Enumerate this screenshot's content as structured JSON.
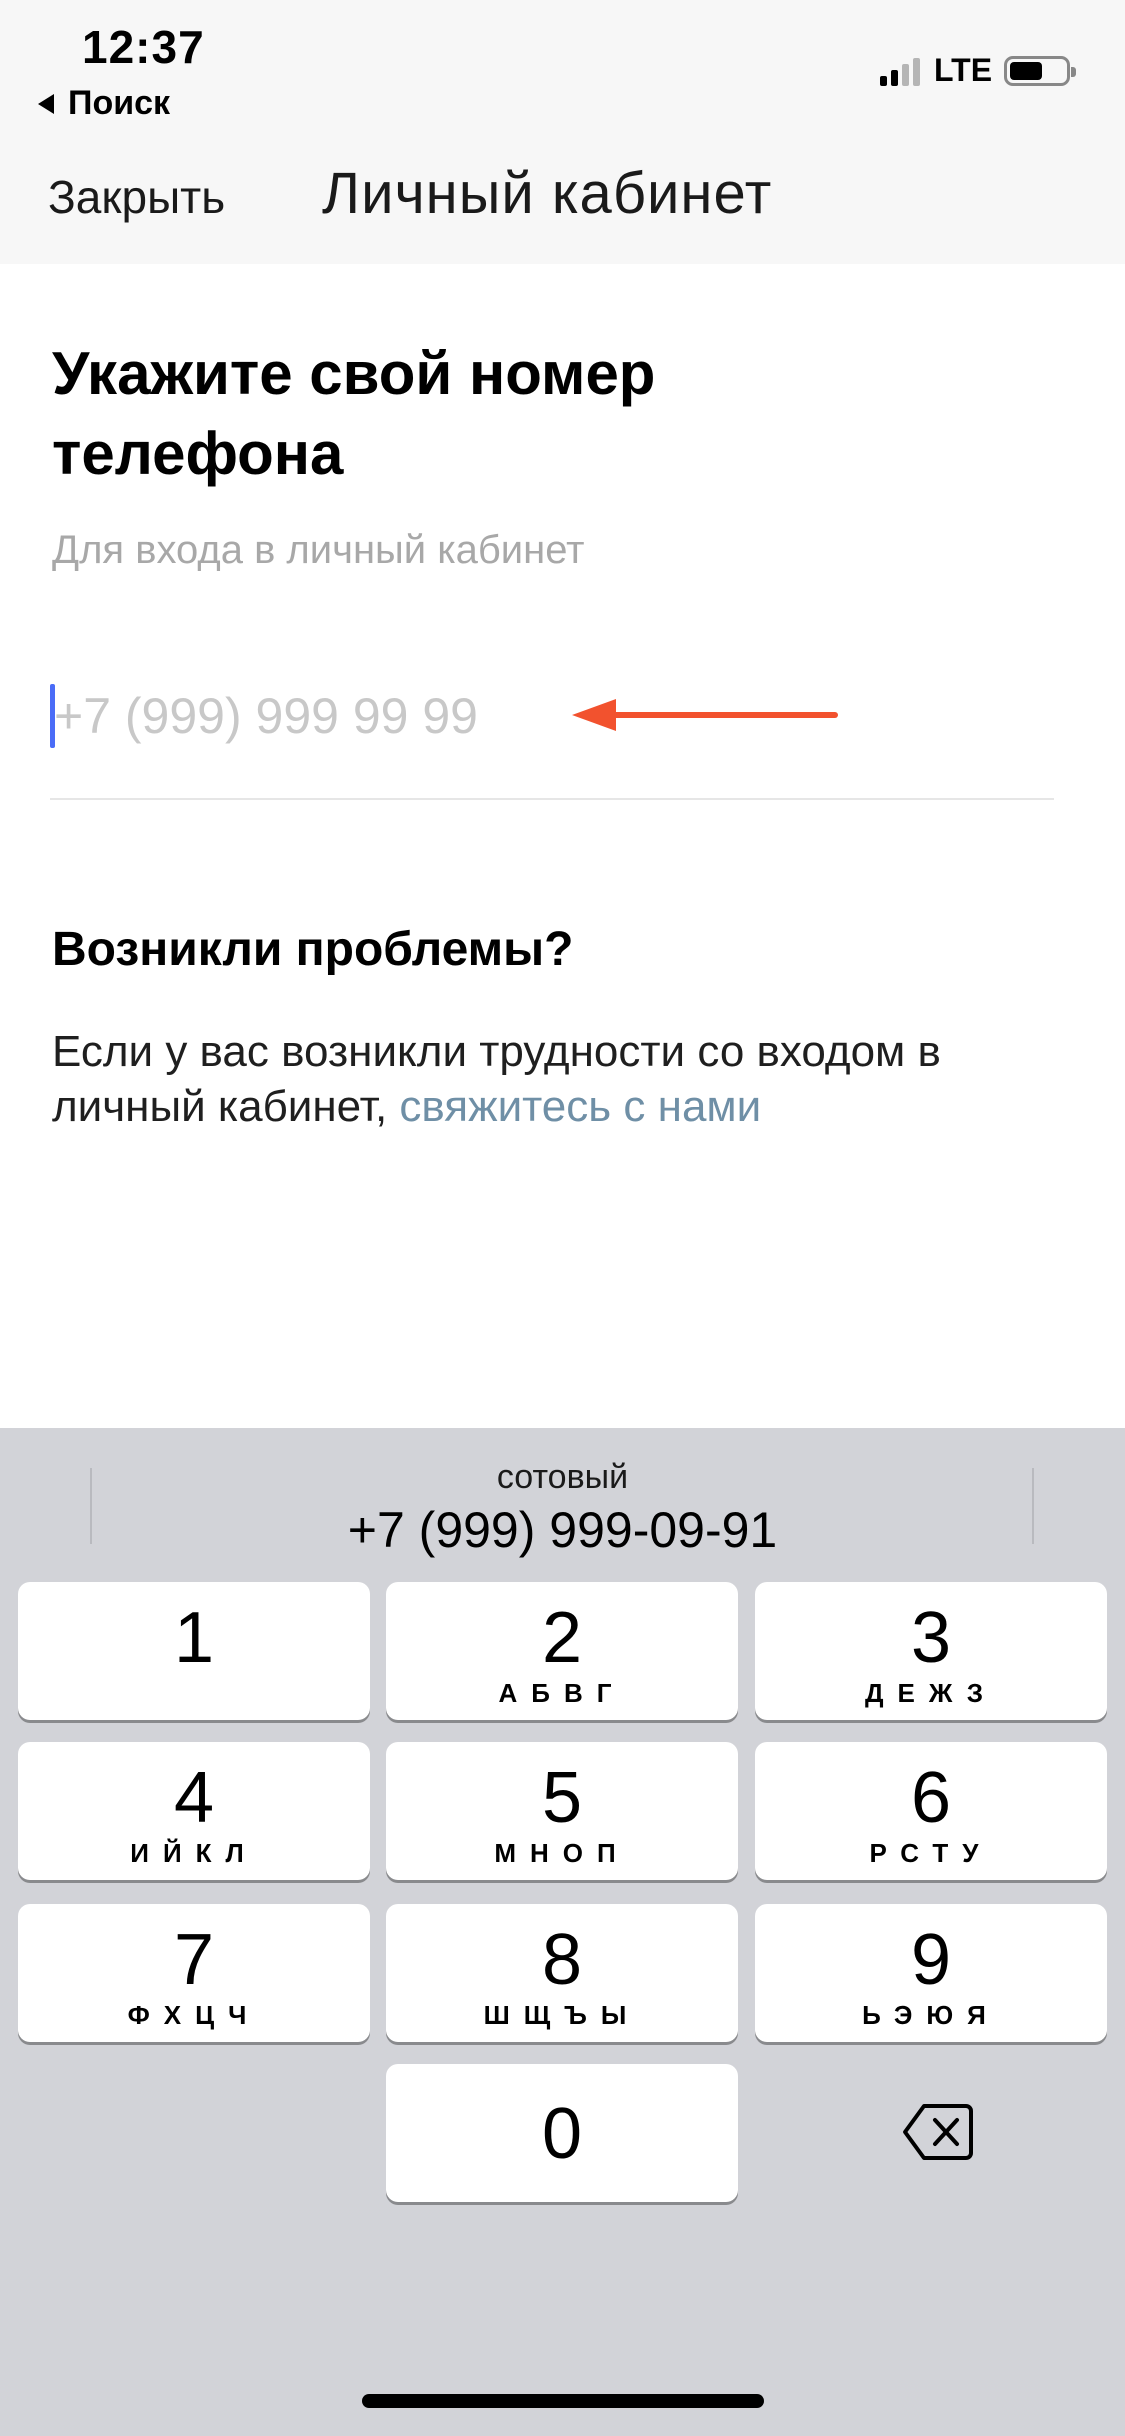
{
  "status_bar": {
    "time": "12:37",
    "back_app_label": "Поиск",
    "network": "LTE",
    "signal_bars_active": 2,
    "signal_bars_total": 4
  },
  "nav": {
    "close_label": "Закрыть",
    "title": "Личный кабинет"
  },
  "form": {
    "heading": "Укажите свой номер телефона",
    "subtitle": "Для входа в личный кабинет",
    "phone_value": "",
    "phone_placeholder": "+7 (999) 999 99 99"
  },
  "help": {
    "title": "Возникли проблемы?",
    "text": "Если у вас возникли трудности со входом в личный кабинет,",
    "link_text": "свяжитесь с нами"
  },
  "keyboard": {
    "suggestion_label": "сотовый",
    "suggestion_number": "+7 (999) 999-09-91",
    "keys": [
      {
        "digit": "1",
        "letters": ""
      },
      {
        "digit": "2",
        "letters": "АБВГ"
      },
      {
        "digit": "3",
        "letters": "ДЕЖЗ"
      },
      {
        "digit": "4",
        "letters": "ИЙКЛ"
      },
      {
        "digit": "5",
        "letters": "МНОП"
      },
      {
        "digit": "6",
        "letters": "РСТУ"
      },
      {
        "digit": "7",
        "letters": "ФХЦЧ"
      },
      {
        "digit": "8",
        "letters": "ШЩЪЫ"
      },
      {
        "digit": "9",
        "letters": "ЬЭЮЯ"
      },
      {
        "digit": "0",
        "letters": ""
      }
    ]
  },
  "colors": {
    "arrow": "#f2522e",
    "link": "#6f8fa6",
    "cursor": "#4a6cf7",
    "keyboard_bg": "#d2d3d8"
  },
  "icons": {
    "back": "back-triangle-icon",
    "backspace": "backspace-icon",
    "arrow": "arrow-left-icon"
  }
}
